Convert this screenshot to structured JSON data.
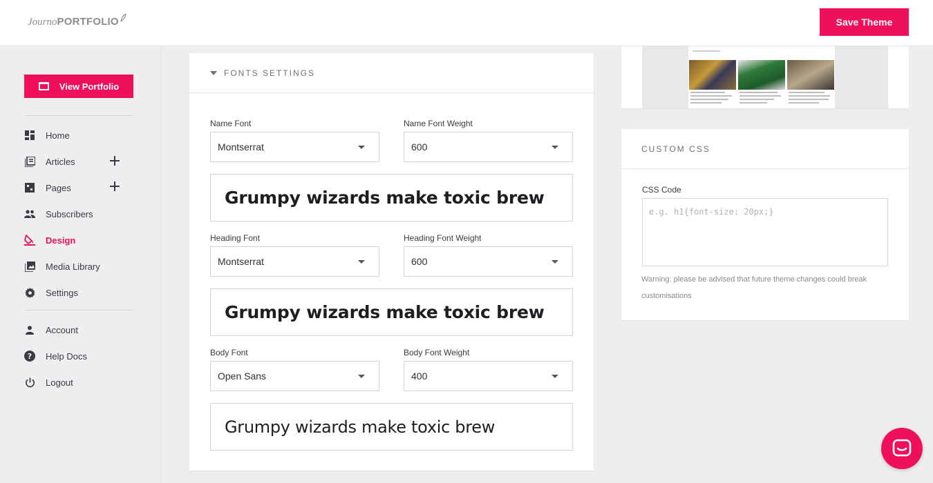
{
  "header": {
    "logo_part1": "Journo",
    "logo_part2": "PORTFOLIO",
    "save_label": "Save Theme"
  },
  "sidebar": {
    "view_portfolio_label": "View Portfolio",
    "items": [
      {
        "label": "Home",
        "icon": "dashboard-icon"
      },
      {
        "label": "Articles",
        "icon": "articles-icon"
      },
      {
        "label": "Pages",
        "icon": "pages-icon"
      },
      {
        "label": "Subscribers",
        "icon": "people-icon"
      },
      {
        "label": "Design",
        "icon": "paint-bucket-icon"
      },
      {
        "label": "Media Library",
        "icon": "photo-library-icon"
      },
      {
        "label": "Settings",
        "icon": "gear-icon"
      }
    ],
    "secondary": [
      {
        "label": "Account",
        "icon": "person-icon"
      },
      {
        "label": "Help Docs",
        "icon": "help-icon"
      },
      {
        "label": "Logout",
        "icon": "power-icon"
      }
    ]
  },
  "fonts": {
    "section_title": "FONTS SETTINGS",
    "name_font_label": "Name Font",
    "name_font_value": "Montserrat",
    "name_weight_label": "Name Font Weight",
    "name_weight_value": "600",
    "heading_font_label": "Heading Font",
    "heading_font_value": "Montserrat",
    "heading_weight_label": "Heading Font Weight",
    "heading_weight_value": "600",
    "body_font_label": "Body Font",
    "body_font_value": "Open Sans",
    "body_weight_label": "Body Font Weight",
    "body_weight_value": "400",
    "preview_text": "Grumpy wizards make toxic brew"
  },
  "custom_css": {
    "section_title": "CUSTOM CSS",
    "code_label": "CSS Code",
    "placeholder": "e.g. h1{font-size: 20px;}",
    "warning": "Warning: please be advised that future theme changes could break customisations"
  },
  "colors": {
    "accent": "#ef0f5d",
    "background": "#eeeef1"
  }
}
